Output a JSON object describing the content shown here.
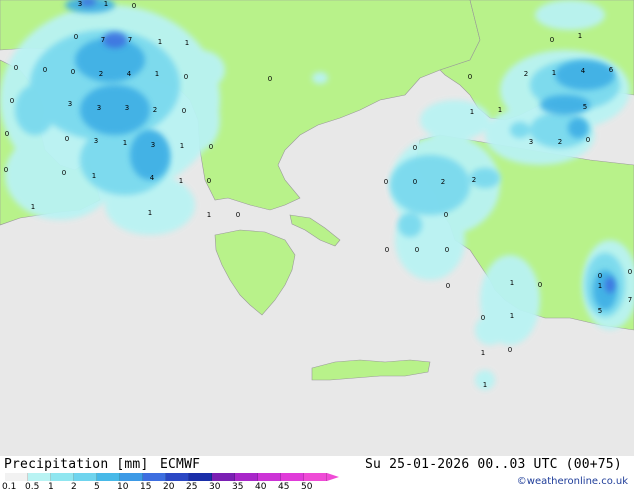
{
  "map": {
    "colors": {
      "sea": "#e8e8e8",
      "land": "#b8f28a",
      "light": "#b9f3f3",
      "mid": "#7ad9ee",
      "medium": "#3eaee5",
      "strong": "#3d6ee0",
      "border": "#888888"
    },
    "values": [
      {
        "t": "3"
      },
      {
        "t": "1"
      },
      {
        "t": "0"
      },
      {
        "t": "0"
      },
      {
        "t": "7"
      },
      {
        "t": "7"
      },
      {
        "t": "1"
      },
      {
        "t": "1"
      },
      {
        "t": "0"
      },
      {
        "t": "0"
      },
      {
        "t": "0"
      },
      {
        "t": "2"
      },
      {
        "t": "4"
      },
      {
        "t": "1"
      },
      {
        "t": "0"
      },
      {
        "t": "0"
      },
      {
        "t": "0"
      },
      {
        "t": "3"
      },
      {
        "t": "3"
      },
      {
        "t": "3"
      },
      {
        "t": "2"
      },
      {
        "t": "0"
      },
      {
        "t": "0"
      },
      {
        "t": "3"
      },
      {
        "t": "1"
      },
      {
        "t": "3"
      },
      {
        "t": "1"
      },
      {
        "t": "0"
      },
      {
        "t": "0"
      },
      {
        "t": "0"
      },
      {
        "t": "1"
      },
      {
        "t": "4"
      },
      {
        "t": "1"
      },
      {
        "t": "0"
      },
      {
        "t": "1"
      },
      {
        "t": "1"
      },
      {
        "t": "1"
      },
      {
        "t": "0"
      },
      {
        "t": "0"
      },
      {
        "t": "0"
      },
      {
        "t": "1"
      },
      {
        "t": "0"
      },
      {
        "t": "2"
      },
      {
        "t": "1"
      },
      {
        "t": "4"
      },
      {
        "t": "6"
      },
      {
        "t": "1"
      },
      {
        "t": "5"
      },
      {
        "t": "1"
      },
      {
        "t": "0"
      },
      {
        "t": "3"
      },
      {
        "t": "2"
      },
      {
        "t": "0"
      },
      {
        "t": "0"
      },
      {
        "t": "0"
      },
      {
        "t": "2"
      },
      {
        "t": "2"
      },
      {
        "t": "0"
      },
      {
        "t": "0"
      },
      {
        "t": "0"
      },
      {
        "t": "0"
      },
      {
        "t": "0"
      },
      {
        "t": "0"
      },
      {
        "t": "0"
      },
      {
        "t": "1"
      },
      {
        "t": "0"
      },
      {
        "t": "1"
      },
      {
        "t": "0"
      },
      {
        "t": "0"
      },
      {
        "t": "1"
      },
      {
        "t": "1"
      },
      {
        "t": "5"
      },
      {
        "t": "7"
      },
      {
        "t": "1"
      }
    ]
  },
  "footer": {
    "title": "Precipitation [mm]",
    "model": "ECMWF",
    "datetime": "Su 25-01-2026 00..03 UTC (00+75)",
    "credit": "©weatheronline.co.uk"
  },
  "legend": {
    "ticks": [
      "0.1",
      "0.5",
      "1",
      "2",
      "5",
      "10",
      "15",
      "20",
      "25",
      "30",
      "35",
      "40",
      "45",
      "50"
    ],
    "colors": [
      "#f2f2f2",
      "#b9f3f3",
      "#90e6f0",
      "#6fd4ee",
      "#47b9e8",
      "#3d9ae6",
      "#3d6ee0",
      "#2a47c4",
      "#1a2ea8",
      "#7a1fb3",
      "#a826c9",
      "#cc33d6",
      "#e03bd9",
      "#ef4bd6"
    ]
  }
}
